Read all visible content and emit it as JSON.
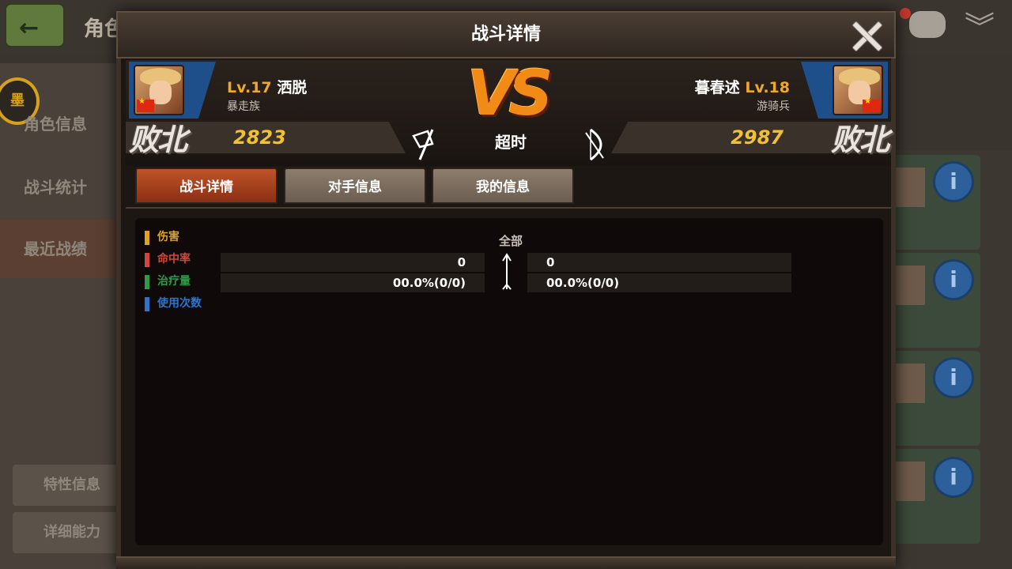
{
  "background": {
    "title": "角色",
    "sidebar": [
      {
        "label": "角色信息",
        "active": false
      },
      {
        "label": "战斗统计",
        "active": false
      },
      {
        "label": "最近战绩",
        "active": true
      }
    ],
    "medal_text": "墨",
    "bottom_buttons": [
      "特性信息",
      "详细能力"
    ]
  },
  "modal": {
    "title": "战斗详情",
    "left_player": {
      "level": "Lv.17",
      "name": "洒脱",
      "class": "暴走族",
      "score": "2823",
      "result": "败北"
    },
    "right_player": {
      "level": "Lv.18",
      "name": "暮春述",
      "class": "游骑兵",
      "score": "2987",
      "result": "败北"
    },
    "match_result": "超时",
    "vs_text": "VS",
    "tabs": [
      "战斗详情",
      "对手信息",
      "我的信息"
    ],
    "active_tab": 0,
    "filter_label": "全部",
    "legend": [
      {
        "label": "伤害",
        "color": "#e0a51c"
      },
      {
        "label": "命中率",
        "color": "#d0473b"
      },
      {
        "label": "治疗量",
        "color": "#2f9a4a"
      },
      {
        "label": "使用次数",
        "color": "#2e74c9"
      }
    ],
    "stats": {
      "left": [
        "0",
        "00.0%(0/0)"
      ],
      "right": [
        "0",
        "00.0%(0/0)"
      ]
    }
  },
  "colors": {
    "accent_orange": "#f0a82c",
    "score_yellow": "#f3c12c",
    "active_tab": "#c0542a",
    "player_plate": "#1f4f8a"
  }
}
